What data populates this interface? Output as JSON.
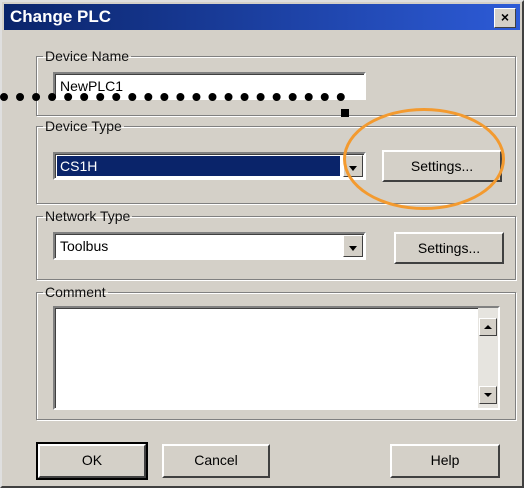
{
  "window": {
    "title": "Change PLC",
    "close_label": "×"
  },
  "device_name": {
    "label": "Device Name",
    "value": "NewPLC1"
  },
  "device_type": {
    "label": "Device Type",
    "value": "CS1H",
    "settings_label": "Settings..."
  },
  "network_type": {
    "label": "Network Type",
    "value": "Toolbus",
    "settings_label": "Settings..."
  },
  "comment": {
    "label": "Comment",
    "value": ""
  },
  "buttons": {
    "ok": "OK",
    "cancel": "Cancel",
    "help": "Help"
  },
  "annotation": {
    "highlight_color": "#f39a2f"
  }
}
